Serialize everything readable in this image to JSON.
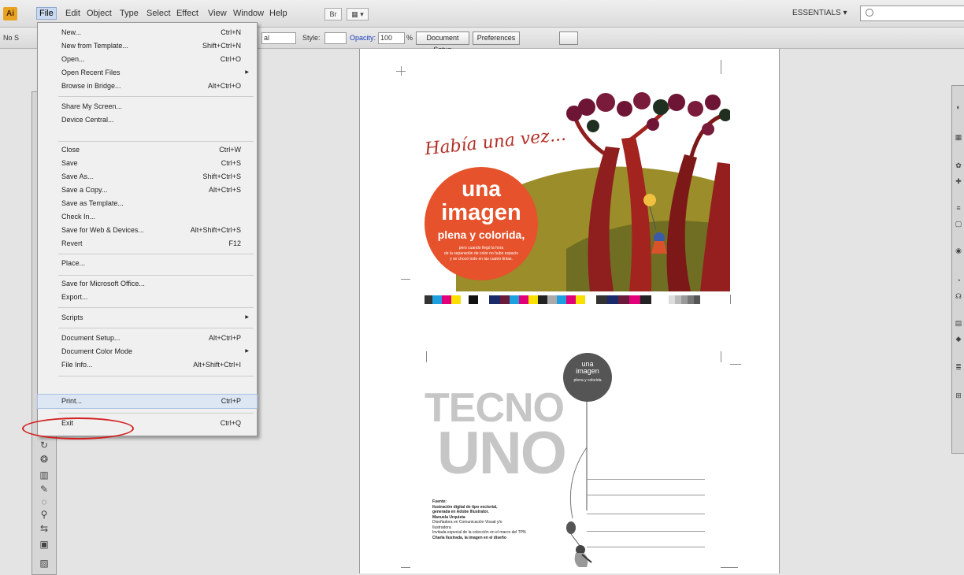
{
  "app": {
    "logo": "Ai"
  },
  "menubar": {
    "items": [
      "File",
      "Edit",
      "Object",
      "Type",
      "Select",
      "Effect",
      "View",
      "Window",
      "Help"
    ],
    "bridge_button": "Br",
    "arrange_button": "▦ ▾",
    "workspace": "ESSENTIALS ▾",
    "search_icon": "search-icon"
  },
  "controlbar": {
    "left_label": "No S",
    "blend_value": "al",
    "style_label": "Style:",
    "opacity_label": "Opacity:",
    "opacity_value": "100",
    "percent": "%",
    "document_setup": "Document Setup",
    "preferences": "Preferences"
  },
  "file_menu": {
    "items": [
      {
        "label": "New...",
        "shortcut": "Ctrl+N"
      },
      {
        "label": "New from Template...",
        "shortcut": "Shift+Ctrl+N"
      },
      {
        "label": "Open...",
        "shortcut": "Ctrl+O"
      },
      {
        "label": "Open Recent Files",
        "shortcut": "",
        "submenu": true
      },
      {
        "label": "Browse in Bridge...",
        "shortcut": "Alt+Ctrl+O"
      },
      {
        "label": "Share My Screen...",
        "shortcut": ""
      },
      {
        "label": "Device Central...",
        "shortcut": ""
      },
      {
        "label": "Close",
        "shortcut": "Ctrl+W"
      },
      {
        "label": "Save",
        "shortcut": "Ctrl+S"
      },
      {
        "label": "Save As...",
        "shortcut": "Shift+Ctrl+S"
      },
      {
        "label": "Save a Copy...",
        "shortcut": "Alt+Ctrl+S"
      },
      {
        "label": "Save as Template...",
        "shortcut": ""
      },
      {
        "label": "Check In...",
        "shortcut": ""
      },
      {
        "label": "Save for Web & Devices...",
        "shortcut": "Alt+Shift+Ctrl+S"
      },
      {
        "label": "Revert",
        "shortcut": "F12"
      },
      {
        "label": "Place...",
        "shortcut": ""
      },
      {
        "label": "Save for Microsoft Office...",
        "shortcut": ""
      },
      {
        "label": "Export...",
        "shortcut": ""
      },
      {
        "label": "Scripts",
        "shortcut": "",
        "submenu": true
      },
      {
        "label": "Document Setup...",
        "shortcut": "Alt+Ctrl+P"
      },
      {
        "label": "Document Color Mode",
        "shortcut": "",
        "submenu": true
      },
      {
        "label": "File Info...",
        "shortcut": "Alt+Shift+Ctrl+I"
      },
      {
        "label": "Print...",
        "shortcut": "Ctrl+P",
        "highlighted": true
      },
      {
        "label": "Exit",
        "shortcut": "Ctrl+Q"
      }
    ]
  },
  "artwork_top": {
    "script_title": "Había una vez...",
    "circle_line1": "una",
    "circle_line2": "imagen",
    "circle_line3": "plena y colorida,",
    "circle_small1": "pero cuando llegó la hora",
    "circle_small2": "de la separación de color no hubo espacio",
    "circle_small3": "y se chocó todo en las cuatro tintas."
  },
  "artwork_bottom": {
    "tecno": "TECNO",
    "uno": "UNO",
    "balloon_l1": "una",
    "balloon_l2": "imagen",
    "balloon_l3": "plena y colorida",
    "credits": [
      "Fuente:",
      "Ilustración digital de tipo vectorial,",
      "generada en Adobe Illustrator.",
      "Manuela Urquieta",
      "Diseñadora en Comunicación Visual y/o",
      "Ilustradora",
      "Invitada especial de la colección en el marco del TPN",
      "Charla Ilustrada, la imagen en el diseño"
    ]
  },
  "colors": {
    "accent_orange": "#e6522b",
    "menu_highlight": "#dde7f4",
    "print_circle": "#d32020"
  }
}
